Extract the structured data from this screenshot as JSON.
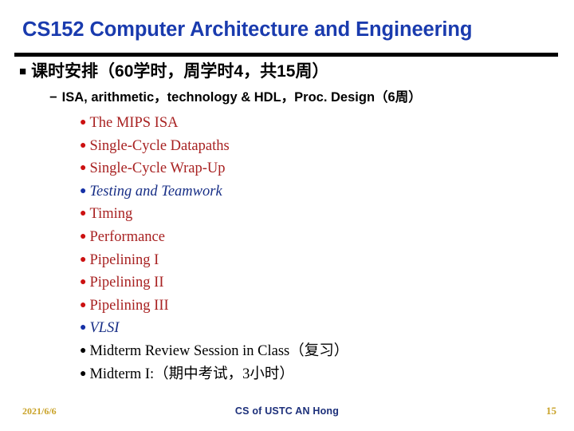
{
  "slide": {
    "title": "CS152 Computer Architecture and Engineering",
    "title_color": "#1A3BAE",
    "outline": {
      "level1": {
        "bullet_glyph": "■",
        "bullet_icon": "black-square-bullet-icon",
        "text": "课时安排（60学时，周学时4，共15周）"
      },
      "level2": {
        "bullet_glyph": "−",
        "bullet_icon": "dash-bullet-icon",
        "text": "ISA, arithmetic，technology & HDL，Proc. Design（6周）"
      },
      "items": [
        {
          "bullet_glyph": "●",
          "text": "The MIPS ISA",
          "style": "red",
          "color": "#A82222",
          "bullet_color": "#CC1111"
        },
        {
          "bullet_glyph": "●",
          "text": "Single-Cycle Datapaths",
          "style": "red",
          "color": "#A82222",
          "bullet_color": "#CC1111"
        },
        {
          "bullet_glyph": "●",
          "text": "Single-Cycle Wrap-Up",
          "style": "red",
          "color": "#A82222",
          "bullet_color": "#CC1111"
        },
        {
          "bullet_glyph": "●",
          "text": "Testing and Teamwork",
          "style": "blue",
          "color": "#172E86",
          "bullet_color": "#1530A6"
        },
        {
          "bullet_glyph": "●",
          "text": "Timing",
          "style": "red",
          "color": "#A82222",
          "bullet_color": "#CC1111"
        },
        {
          "bullet_glyph": "●",
          "text": "Performance",
          "style": "red",
          "color": "#A82222",
          "bullet_color": "#CC1111"
        },
        {
          "bullet_glyph": "●",
          "text": "Pipelining I",
          "style": "red",
          "color": "#A82222",
          "bullet_color": "#CC1111"
        },
        {
          "bullet_glyph": "●",
          "text": "Pipelining II",
          "style": "red",
          "color": "#A82222",
          "bullet_color": "#CC1111"
        },
        {
          "bullet_glyph": "●",
          "text": "Pipelining III",
          "style": "red",
          "color": "#A82222",
          "bullet_color": "#CC1111"
        },
        {
          "bullet_glyph": "●",
          "text": "VLSI",
          "style": "blue",
          "color": "#172E86",
          "bullet_color": "#1530A6"
        },
        {
          "bullet_glyph": "●",
          "text": "Midterm Review Session in Class（复习）",
          "style": "black",
          "color": "#000000",
          "bullet_color": "#000000"
        },
        {
          "bullet_glyph": "●",
          "text": "Midterm I:（期中考试，3小时）",
          "style": "black",
          "color": "#000000",
          "bullet_color": "#000000"
        }
      ]
    },
    "footer": {
      "date": "2021/6/6",
      "center": "CS of USTC AN Hong",
      "page_number": "15",
      "accent_color": "#C9A227",
      "center_color": "#1C2F7A"
    }
  }
}
